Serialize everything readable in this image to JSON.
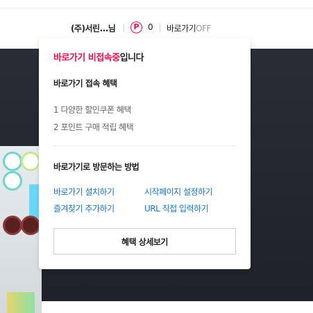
{
  "header": {
    "user_name": "(주)서린...님",
    "point_icon_glyph": "P",
    "point_count": "0",
    "shortcut_label": "바로가기",
    "shortcut_status": "OFF"
  },
  "popup": {
    "title_highlight": "바로가기 비접속중",
    "title_rest": "입니다",
    "benefits_title": "바로가기 접속 혜택",
    "benefits": [
      "1 다양한 할인쿠폰 혜택",
      "2 포인트 구매 적립 혜택"
    ],
    "methods_title": "바로가기로 방문하는 방법",
    "methods": [
      "바로가기 설치하기",
      "시작페이지 설정하기",
      "즐겨찾기 추가하기",
      "URL 직접 입력하기"
    ],
    "detail_button": "혜택 상세보기"
  },
  "colors": {
    "accent": "#e0104e",
    "link": "#1a73c8",
    "background_dark": "#24272e"
  }
}
